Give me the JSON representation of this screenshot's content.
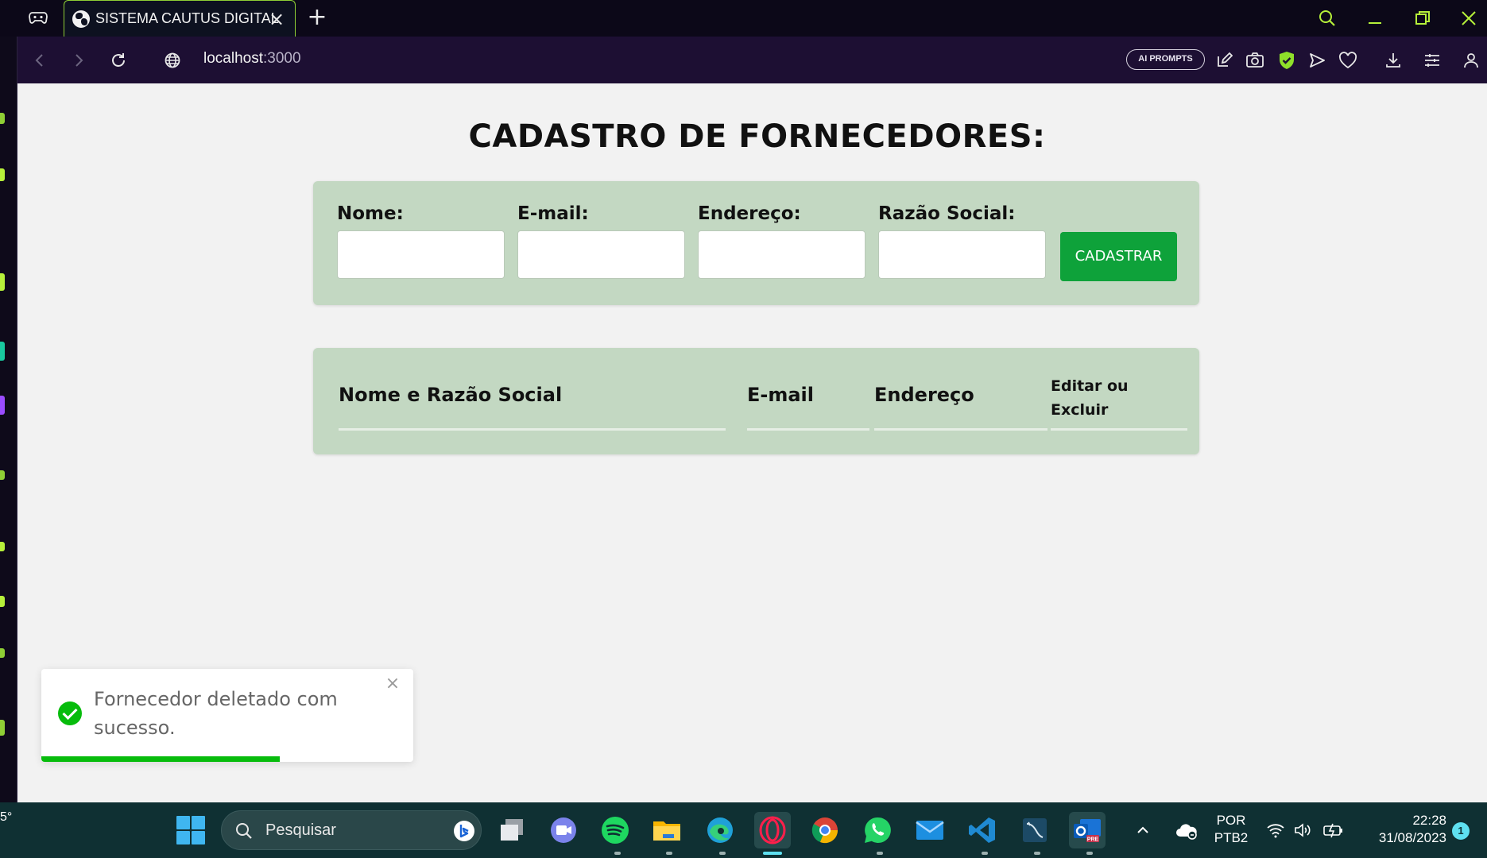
{
  "browser": {
    "tab_title": "SISTEMA CAUTUS DIGITAL",
    "url_host": "localhost",
    "url_port": ":3000",
    "ai_prompts_label": "AI PROMPTS",
    "accent_color": "#8fcf35"
  },
  "page": {
    "title": "CADASTRO DE FORNECEDORES:",
    "form": {
      "fields": [
        {
          "label": "Nome:",
          "value": ""
        },
        {
          "label": "E-mail:",
          "value": ""
        },
        {
          "label": "Endereço:",
          "value": ""
        },
        {
          "label": "Razão Social:",
          "value": ""
        }
      ],
      "submit_label": "CADASTRAR",
      "submit_color": "#0ea23a",
      "card_color": "#c3d8c2"
    },
    "table": {
      "headers": [
        "Nome e Razão Social",
        "E-mail",
        "Endereço",
        "Editar ou",
        "Excluir"
      ],
      "rows": []
    }
  },
  "toast": {
    "message": "Fornecedor deletado com sucesso.",
    "type": "success",
    "progress": 0.64,
    "color": "#07bc0c"
  },
  "taskbar": {
    "weather_temp": "5°",
    "search_placeholder": "Pesquisar",
    "language_line1": "POR",
    "language_line2": "PTB2",
    "time": "22:28",
    "date": "31/08/2023",
    "notifications": "1",
    "apps": [
      "task-view",
      "teams",
      "spotify",
      "file-explorer",
      "edge",
      "opera",
      "chrome",
      "whatsapp",
      "mail",
      "vscode",
      "mysql-workbench",
      "outlook-preview"
    ]
  }
}
